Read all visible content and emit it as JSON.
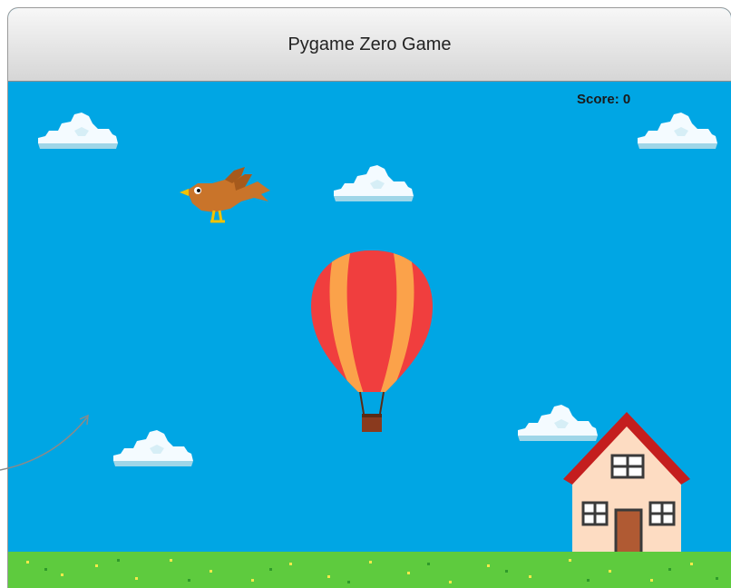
{
  "window": {
    "title": "Pygame Zero Game"
  },
  "game": {
    "score_text": "Score: 0",
    "sprites": [
      "cloud",
      "cloud",
      "cloud",
      "cloud",
      "cloud",
      "bird",
      "hot-air-balloon",
      "house"
    ],
    "colors": {
      "sky": "#00a6e4",
      "grass": "#5ecb3e",
      "balloon_red": "#f03e3e",
      "balloon_orange": "#fba24a",
      "roof": "#c41e1e",
      "house_wall": "#fddcc2",
      "door": "#b05a33",
      "bird": "#c9742a"
    }
  }
}
